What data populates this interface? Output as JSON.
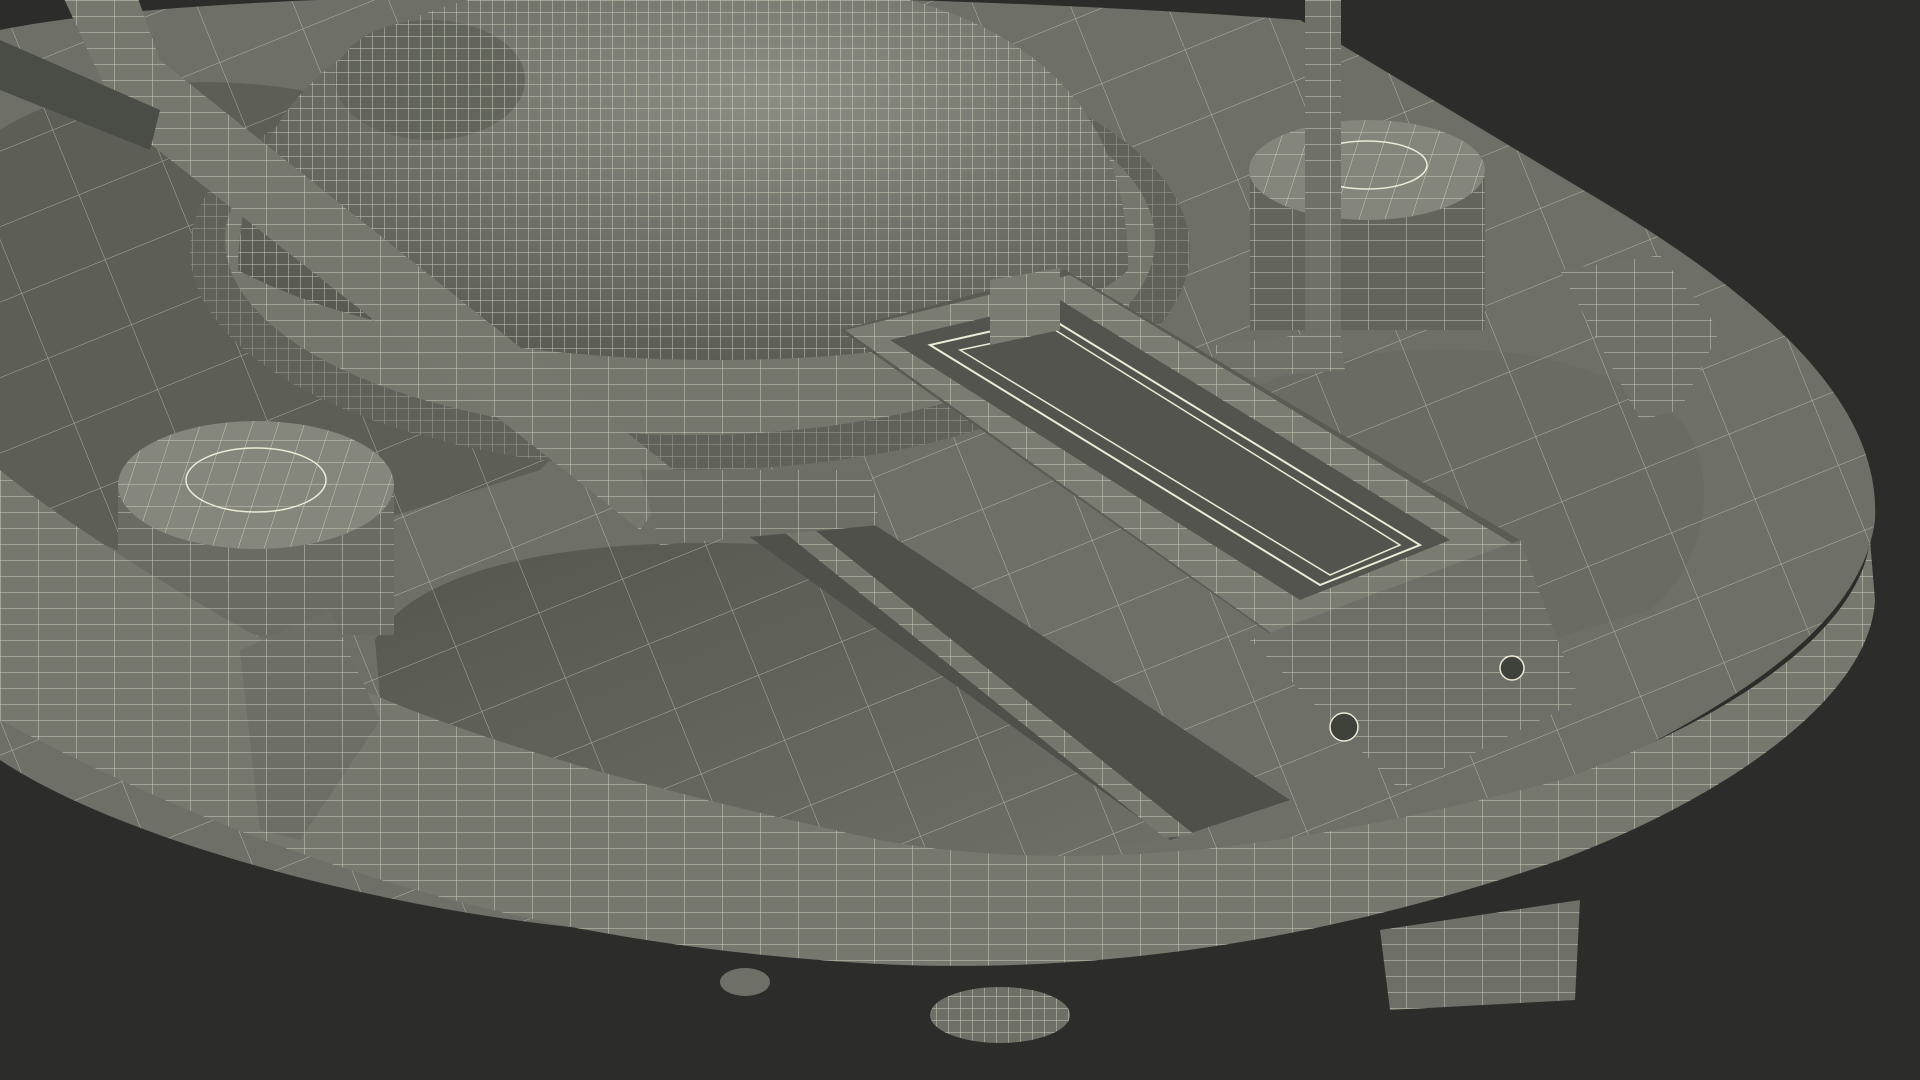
{
  "scene": {
    "background_color": "#2c2c2b",
    "shell_color": "#7b7d72",
    "shell_dark_color": "#54564e",
    "floor_color": "#65675e",
    "wire_color": "#ecebd7"
  }
}
